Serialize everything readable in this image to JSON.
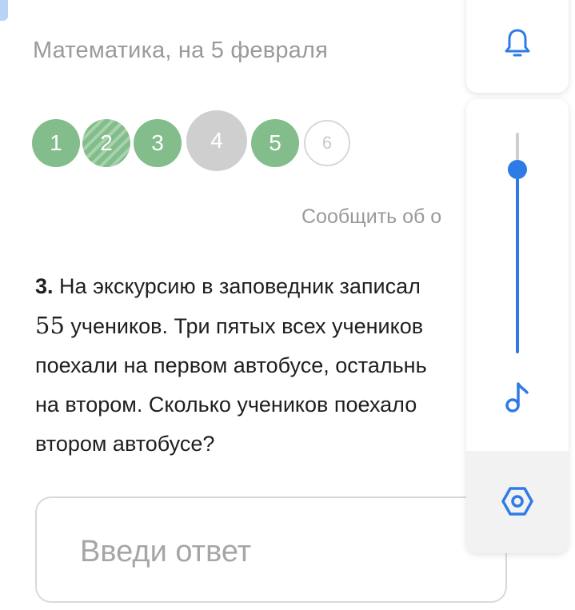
{
  "header": {
    "subject_title": "Математика, на 5 февраля"
  },
  "progress": {
    "steps": [
      {
        "label": "1",
        "state": "done"
      },
      {
        "label": "2",
        "state": "done-striped"
      },
      {
        "label": "3",
        "state": "done"
      },
      {
        "label": "4",
        "state": "current"
      },
      {
        "label": "5",
        "state": "done"
      },
      {
        "label": "6",
        "state": "pending"
      }
    ]
  },
  "report": {
    "label": "Сообщить об о"
  },
  "question": {
    "number": "3.",
    "line1": "На экскурсию в заповедник записал",
    "count": "55",
    "line2_rest": "учеников. Три пятых всех учеников",
    "line3": "поехали на первом автобусе, остальнь",
    "line4": "на втором. Сколько учеников поехало",
    "line5": "втором автобусе?"
  },
  "answer": {
    "placeholder": "Введи ответ",
    "value": ""
  },
  "side_panel": {
    "bell_icon": "bell-icon",
    "volume_level_percent": 85,
    "music_icon": "music-note-icon",
    "settings_icon": "hexagon-settings-icon"
  },
  "colors": {
    "done": "#82bd8b",
    "current": "#cfcfcf",
    "accent": "#2f7be5",
    "muted_text": "#9a9a9a"
  }
}
